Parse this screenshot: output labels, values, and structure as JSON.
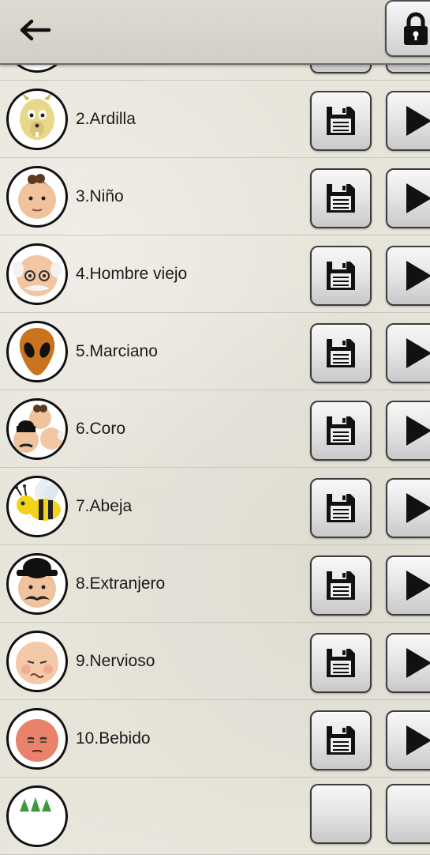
{
  "header": {
    "back_icon": "arrow-left-icon",
    "lock_icon": "lock-icon"
  },
  "voices": [
    {
      "label": "2.Ardilla",
      "avatar": "squirrel-icon"
    },
    {
      "label": "3.Niño",
      "avatar": "child-face-icon"
    },
    {
      "label": "4.Hombre viejo",
      "avatar": "old-man-face-icon"
    },
    {
      "label": "5.Marciano",
      "avatar": "alien-face-icon"
    },
    {
      "label": "6.Coro",
      "avatar": "choir-faces-icon"
    },
    {
      "label": "7.Abeja",
      "avatar": "bee-icon"
    },
    {
      "label": "8.Extranjero",
      "avatar": "foreigner-face-icon"
    },
    {
      "label": "9.Nervioso",
      "avatar": "nervous-face-icon"
    },
    {
      "label": "10.Bebido",
      "avatar": "drunk-face-icon"
    }
  ],
  "row_actions": {
    "save_icon": "save-floppy-icon",
    "play_icon": "play-icon"
  }
}
